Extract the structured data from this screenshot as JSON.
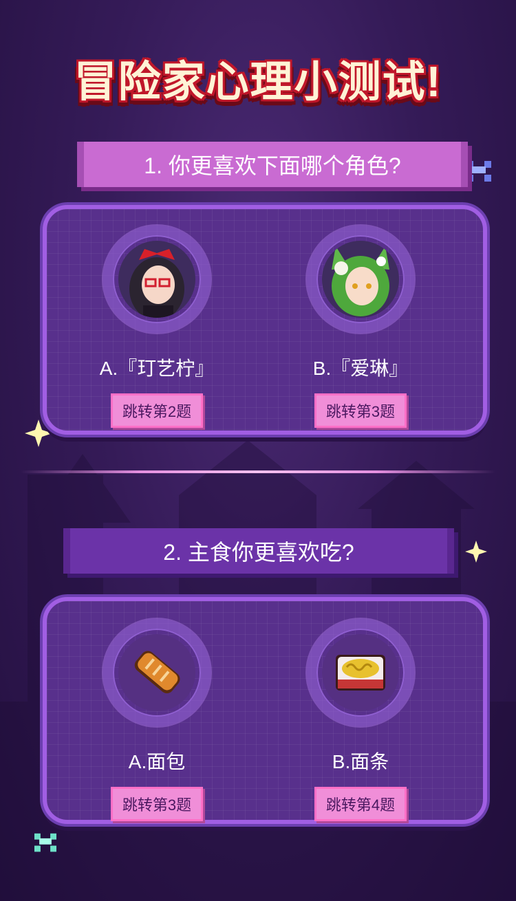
{
  "title": "冒险家心理小测试!",
  "questions": [
    {
      "prompt": "1. 你更喜欢下面哪个角色?",
      "options": [
        {
          "label": "A.『玎艺柠』",
          "jump": "跳转第2题",
          "icon": "girl-red-ribbon-glasses-portrait"
        },
        {
          "label": "B.『爱琳』",
          "jump": "跳转第3题",
          "icon": "green-hair-fox-girl-portrait"
        }
      ]
    },
    {
      "prompt": "2. 主食你更喜欢吃?",
      "options": [
        {
          "label": "A.面包",
          "jump": "跳转第3题",
          "icon": "bread-icon"
        },
        {
          "label": "B.面条",
          "jump": "跳转第4题",
          "icon": "noodle-bowl-icon"
        }
      ]
    }
  ],
  "colors": {
    "background": "#351b58",
    "panel": "#58308c",
    "panel_border": "#a15ee3",
    "banner_q1": "#c96bd2",
    "banner_q2": "#6b33a8",
    "jump_bg": "#f08ed8",
    "title_outline": "#c0172a"
  }
}
